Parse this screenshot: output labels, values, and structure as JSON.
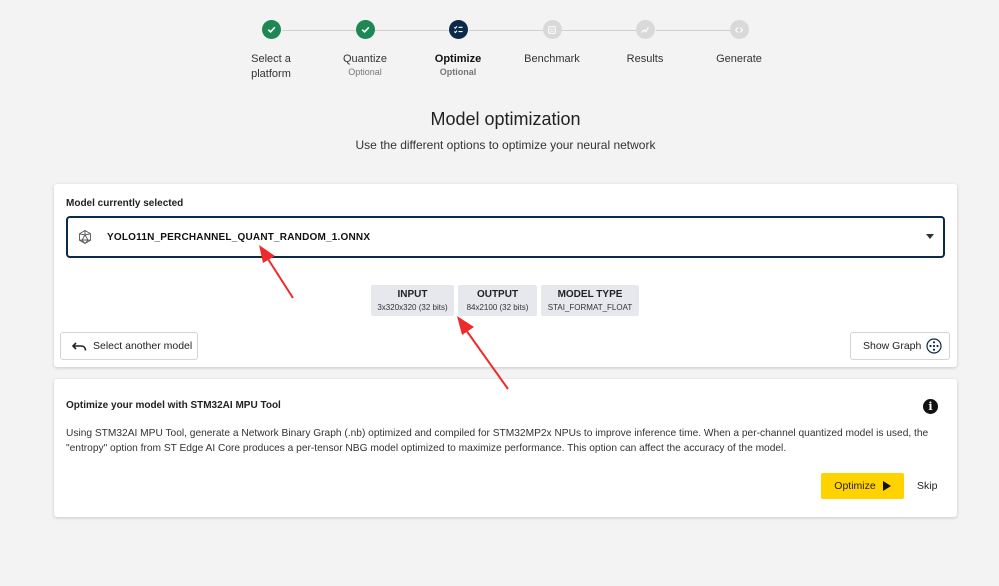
{
  "stepper": {
    "steps": [
      {
        "label": "Select a platform",
        "label_line1": "Select a",
        "label_line2": "platform",
        "sub": "",
        "state": "done"
      },
      {
        "label": "Quantize",
        "sub": "Optional",
        "state": "done"
      },
      {
        "label": "Optimize",
        "sub": "Optional",
        "state": "current"
      },
      {
        "label": "Benchmark",
        "sub": "",
        "state": "todo"
      },
      {
        "label": "Results",
        "sub": "",
        "state": "todo"
      },
      {
        "label": "Generate",
        "sub": "",
        "state": "todo"
      }
    ]
  },
  "header": {
    "title": "Model optimization",
    "subtitle": "Use the different options to optimize your neural network"
  },
  "model_card": {
    "label": "Model currently selected",
    "selected_model": "YOLO11N_PERCHANNEL_QUANT_RANDOM_1.ONNX",
    "tags": [
      {
        "title": "INPUT",
        "value": "3x320x320 (32 bits)"
      },
      {
        "title": "OUTPUT",
        "value": "84x2100 (32 bits)"
      },
      {
        "title": "MODEL TYPE",
        "value": "STAI_FORMAT_FLOAT"
      }
    ],
    "select_another_label": "Select another model",
    "show_graph_label": "Show Graph"
  },
  "optimize_card": {
    "title": "Optimize your model with STM32AI MPU Tool",
    "info_glyph": "i",
    "description": "Using STM32AI MPU Tool, generate a Network Binary Graph (.nb) optimized and compiled for STM32MP2x NPUs to improve inference time. When a per-channel quantized model is used, the \"entropy\" option from ST Edge AI Core produces a per-tensor NBG model optimized to maximize performance. This option can affect the accuracy of the model.",
    "optimize_label": "Optimize",
    "skip_label": "Skip"
  },
  "colors": {
    "done": "#1e8753",
    "current": "#0b2a4a",
    "todo": "#d9d9d9",
    "accent_button": "#ffd200",
    "annotation_arrow": "#ee2b2b"
  },
  "icons": {
    "step_done": "check-icon",
    "step_current": "checklist-icon",
    "step_benchmark": "list-icon",
    "step_results": "chart-icon",
    "step_generate": "code-icon",
    "model": "polyhedron-icon",
    "caret": "caret-down-icon",
    "undo": "undo-icon",
    "graph": "graph-icon",
    "info": "info-icon",
    "play": "play-icon"
  }
}
